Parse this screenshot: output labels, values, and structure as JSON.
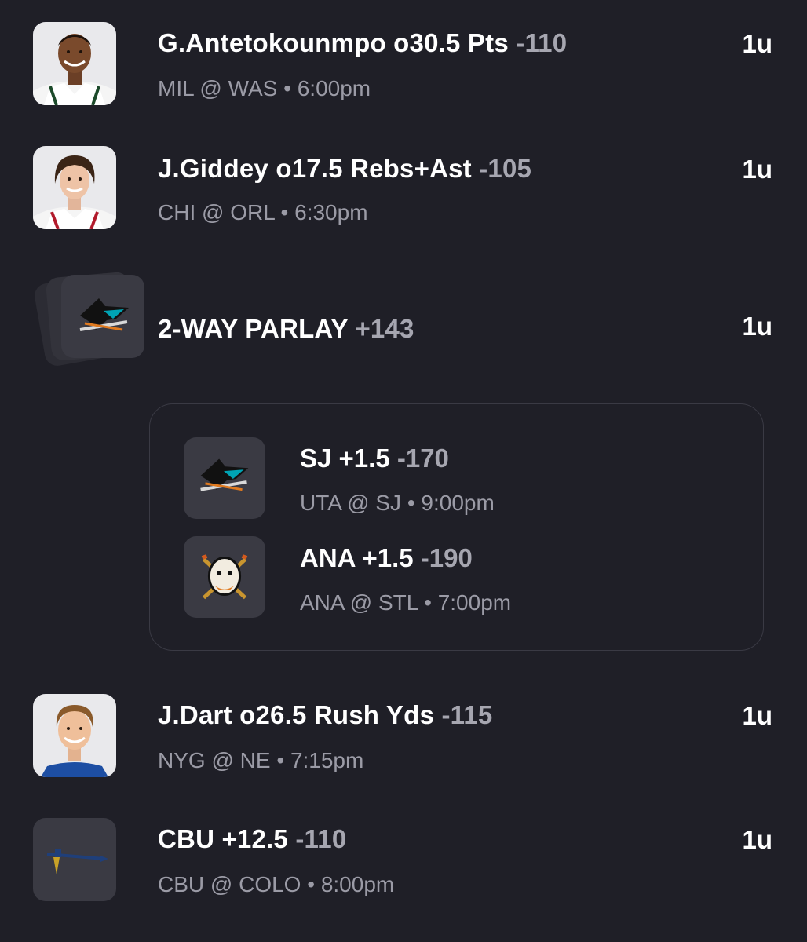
{
  "bets": [
    {
      "title": "G.Antetokounmpo o30.5 Pts",
      "odds": "-110",
      "matchup": "MIL @ WAS",
      "time": "6:00pm",
      "units": "1u",
      "image": "player-headshot"
    },
    {
      "title": "J.Giddey o17.5 Rebs+Ast",
      "odds": "-105",
      "matchup": "CHI @ ORL",
      "time": "6:30pm",
      "units": "1u",
      "image": "player-headshot"
    },
    {
      "title": "2-WAY PARLAY",
      "odds": "+143",
      "units": "1u",
      "image": "sharks-logo-stack",
      "legs": [
        {
          "title": "SJ +1.5",
          "odds": "-170",
          "matchup": "UTA @ SJ",
          "time": "9:00pm",
          "image": "sharks-logo"
        },
        {
          "title": "ANA +1.5",
          "odds": "-190",
          "matchup": "ANA @ STL",
          "time": "7:00pm",
          "image": "ducks-logo"
        }
      ]
    },
    {
      "title": "J.Dart o26.5 Rush Yds",
      "odds": "-115",
      "matchup": "NYG @ NE",
      "time": "7:15pm",
      "units": "1u",
      "image": "player-headshot"
    },
    {
      "title": "CBU +12.5",
      "odds": "-110",
      "matchup": "CBU @ COLO",
      "time": "8:00pm",
      "units": "1u",
      "image": "lancers-logo"
    }
  ],
  "separator": "•",
  "colors": {
    "background": "#1f1f27",
    "tile": "#3a3a43",
    "odds_text": "#a6a6b0",
    "meta_text": "#9b9ba6"
  }
}
